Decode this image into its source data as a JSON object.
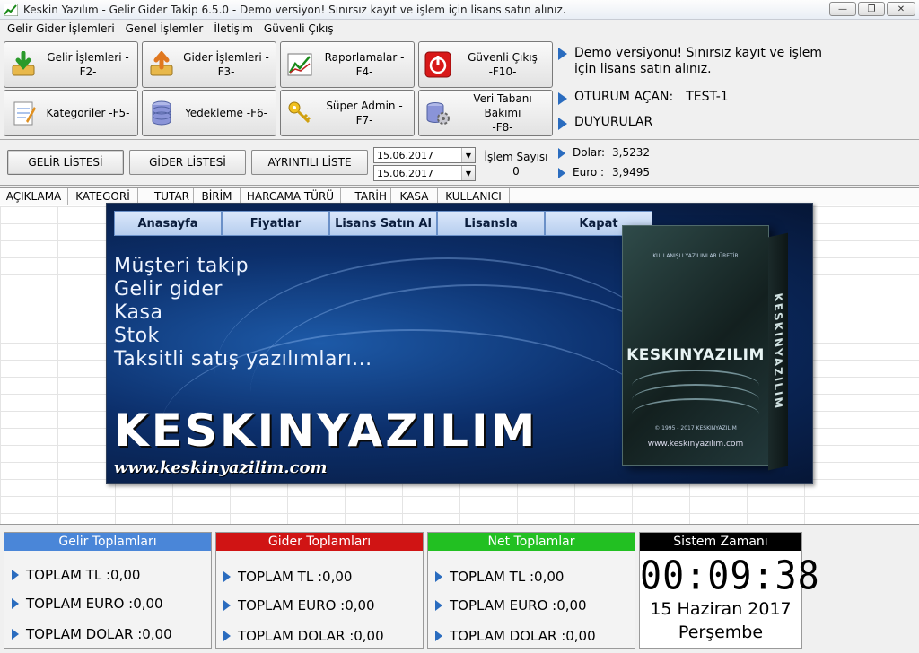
{
  "window": {
    "title": "Keskin Yazılım - Gelir Gider Takip 6.5.0  - Demo versiyon! Sınırsız kayıt ve işlem için lisans satın alınız.",
    "minimize": "—",
    "restore": "❐",
    "close": "✕"
  },
  "menu": [
    "Gelir Gider İşlemleri",
    "Genel İşlemler",
    "İletişim",
    "Güvenli Çıkış"
  ],
  "toolbar": {
    "buttons": [
      {
        "label": "Gelir İşlemleri -F2-"
      },
      {
        "label": "Gider İşlemleri -F3-"
      },
      {
        "label": "Raporlamalar -F4-"
      },
      {
        "label": "Güvenli Çıkış\n-F10-"
      },
      {
        "label": "Kategoriler -F5-"
      },
      {
        "label": "Yedekleme -F6-"
      },
      {
        "label": "Süper Admin -F7-"
      },
      {
        "label": "Veri Tabanı Bakımı\n-F8-"
      }
    ],
    "demo_notice": "Demo versiyonu! Sınırsız kayıt ve işlem için lisans satın alınız.",
    "session_label": "OTURUM AÇAN:",
    "session_user": "TEST-1",
    "announcements": "DUYURULAR"
  },
  "filter": {
    "tabs": [
      "GELİR LİSTESİ",
      "GİDER LİSTESİ",
      "AYRINTILI LİSTE"
    ],
    "date_from": "15.06.2017",
    "date_to": "15.06.2017",
    "count_label": "İşlem Sayısı",
    "count_value": "0",
    "dollar_label": "Dolar:",
    "dollar_value": "3,5232",
    "euro_label": "Euro :",
    "euro_value": "3,9495"
  },
  "grid": {
    "columns": [
      "AÇIKLAMA",
      "KATEGORİ",
      "TUTAR",
      "BİRİM",
      "HARCAMA TÜRÜ",
      "TARİH",
      "KASA",
      "KULLANICI"
    ]
  },
  "banner": {
    "nav": [
      "Anasayfa",
      "Fiyatlar",
      "Lisans Satın Al",
      "Lisansla",
      "Kapat"
    ],
    "slogan": [
      "Müşteri takip",
      "Gelir gider",
      "Kasa",
      "Stok",
      "Taksitli satış yazılımları..."
    ],
    "brand": "KESKINYAZILIM",
    "url": "www.keskinyazilim.com",
    "box_tagline": "KULLANIŞLI YAZILIMLAR ÜRETİR",
    "box_brand": "KESKINYAZILIM",
    "box_side": "KESKINYAZILIM",
    "box_copy": "© 1995 - 2017 KESKINYAZILIM",
    "box_web": "www.keskinyazilim.com"
  },
  "totals": {
    "income": {
      "title": "Gelir Toplamları",
      "tl": "TOPLAM TL :0,00",
      "euro": "TOPLAM EURO :0,00",
      "dollar": "TOPLAM DOLAR :0,00"
    },
    "expense": {
      "title": "Gider Toplamları",
      "tl": "TOPLAM TL :0,00",
      "euro": "TOPLAM EURO :0,00",
      "dollar": "TOPLAM DOLAR :0,00"
    },
    "net": {
      "title": "Net Toplamlar",
      "tl": "TOPLAM TL :0,00",
      "euro": "TOPLAM EURO :0,00",
      "dollar": "TOPLAM DOLAR :0,00"
    }
  },
  "clock": {
    "title": "Sistem Zamanı",
    "time": "00:09:38",
    "date": "15 Haziran 2017",
    "day": "Perşembe"
  },
  "colors": {
    "income_header": "#4a86d8",
    "expense_header": "#d01414",
    "net_header": "#22c022",
    "accent_arrow": "#2a6cbf"
  },
  "icons": {
    "income": "download-arrow-icon",
    "expense": "upload-arrow-icon",
    "reports": "chart-icon",
    "exit": "power-icon",
    "categories": "notepad-icon",
    "backup": "database-icon",
    "admin": "key-icon",
    "maintenance": "gear-icon"
  }
}
